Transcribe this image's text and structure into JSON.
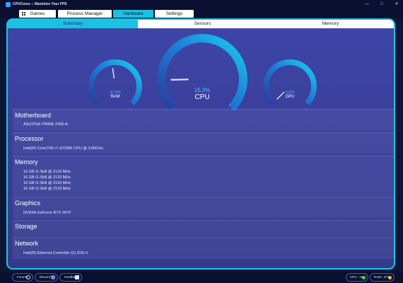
{
  "window": {
    "title": "CPUCores :: Maximize Your FPS",
    "minimize_glyph": "—",
    "maximize_glyph": "□",
    "close_glyph": "✕"
  },
  "nav": {
    "items": [
      "Games",
      "Process Manager",
      "Hardware",
      "Settings"
    ],
    "active": "Hardware"
  },
  "tabs": {
    "items": [
      "Summary",
      "Sensors",
      "Memory"
    ],
    "active": "Summary"
  },
  "gauges": {
    "ram": {
      "label": "RAM",
      "value_text": "47.0%",
      "value": 47.0
    },
    "cpu": {
      "label": "CPU",
      "value_text": "16.3%",
      "value": 16.3
    },
    "gpu": {
      "label": "GPU",
      "value_text": "0.0%",
      "value": 0.0
    }
  },
  "sections": {
    "motherboard": {
      "title": "Motherboard",
      "lines": [
        "ASUSTeK PRIME Z490-A"
      ]
    },
    "processor": {
      "title": "Processor",
      "lines": [
        "Intel(R) Core(TM) i7-10700K CPU @ 3.80GHz"
      ]
    },
    "memory": {
      "title": "Memory",
      "lines": [
        "16 GB G-Skill @ 2133 MHz",
        "16 GB G-Skill @ 2133 MHz",
        "16 GB G-Skill @ 2133 MHz",
        "16 GB G-Skill @ 2133 MHz"
      ]
    },
    "graphics": {
      "title": "Graphics",
      "lines": [
        "NVIDIA GeForce RTX 3070"
      ]
    },
    "storage": {
      "title": "Storage",
      "lines": []
    },
    "network": {
      "title": "Network",
      "lines": [
        "Intel(R) Ethernet Controller (2) I225-V"
      ]
    }
  },
  "statusbar": {
    "forums": "Forums",
    "discord": "Discord",
    "feedback": "Feedback",
    "cpu_text": "CPU : 16%",
    "ram_text": "RAM : 47%"
  },
  "colors": {
    "accent": "#19c6e6",
    "gauge_value": "#3dc7ff",
    "status_ok": "#3ddc3d",
    "status_warn": "#e8c22a"
  },
  "icons": {
    "grid": "grid-icon",
    "forums": "arrow-circle-icon",
    "discord": "discord-icon",
    "feedback": "feedback-icon"
  }
}
